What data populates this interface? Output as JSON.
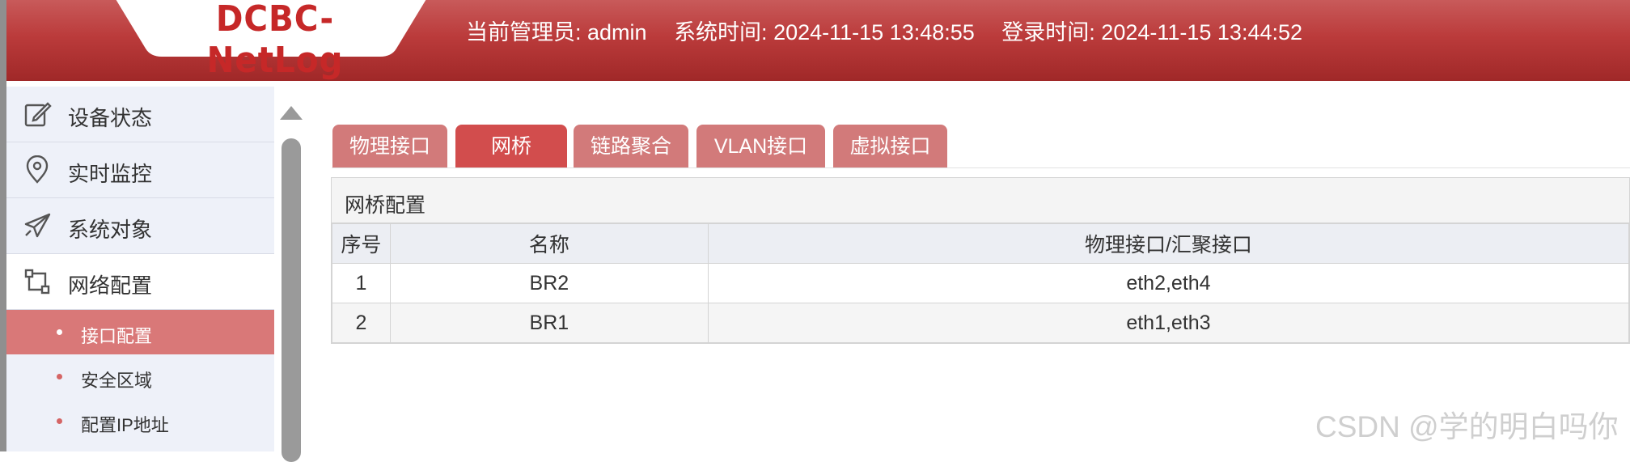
{
  "header": {
    "logo": "DCBC-NetLog",
    "admin": "当前管理员: admin",
    "system_time": "系统时间: 2024-11-15 13:48:55",
    "login_time": "登录时间: 2024-11-15 13:44:52"
  },
  "sidebar": {
    "items": [
      {
        "label": "设备状态",
        "icon": "edit-icon"
      },
      {
        "label": "实时监控",
        "icon": "location-pin-icon"
      },
      {
        "label": "系统对象",
        "icon": "paper-plane-icon"
      },
      {
        "label": "网络配置",
        "icon": "network-connector-icon"
      }
    ],
    "sub_items": [
      {
        "label": "接口配置",
        "active": true
      },
      {
        "label": "安全区域",
        "active": false
      },
      {
        "label": "配置IP地址",
        "active": false
      }
    ]
  },
  "tabs": [
    {
      "label": "物理接口",
      "active": false
    },
    {
      "label": "网桥",
      "active": true
    },
    {
      "label": "链路聚合",
      "active": false
    },
    {
      "label": "VLAN接口",
      "active": false
    },
    {
      "label": "虚拟接口",
      "active": false
    }
  ],
  "panel": {
    "title": "网桥配置",
    "columns": [
      "序号",
      "名称",
      "物理接口/汇聚接口"
    ],
    "rows": [
      {
        "index": "1",
        "name": "BR2",
        "interfaces": "eth2,eth4"
      },
      {
        "index": "2",
        "name": "BR1",
        "interfaces": "eth1,eth3"
      }
    ]
  },
  "watermark": "CSDN @学的明白吗你",
  "colors": {
    "header": "#bb3b3b",
    "tab": "#d27a7a",
    "tab_active": "#d24d4d",
    "sidebar_active": "#d97878",
    "sidebar_bg": "#eef1f9"
  }
}
